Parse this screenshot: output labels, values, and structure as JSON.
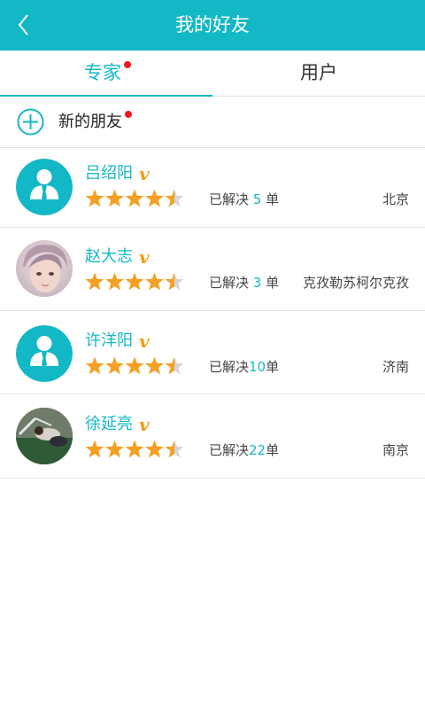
{
  "header": {
    "title": "我的好友"
  },
  "tabs": [
    {
      "label": "专家",
      "active": true,
      "has_dot": true
    },
    {
      "label": "用户",
      "active": false
    }
  ],
  "new_friends": {
    "label": "新的朋友",
    "has_dot": true
  },
  "friends": [
    {
      "name": "吕绍阳",
      "badge": "v",
      "rating": 4.5,
      "solved_prefix": "已解决",
      "solved_count": "5",
      "solved_suffix": "单",
      "city": "北京",
      "avatar": "default"
    },
    {
      "name": "赵大志",
      "badge": "v",
      "rating": 4.5,
      "solved_prefix": "已解决",
      "solved_count": "3",
      "solved_suffix": "单",
      "city": "克孜勒苏柯尔克孜",
      "avatar": "photo-person"
    },
    {
      "name": "许洋阳",
      "badge": "v",
      "rating": 4.5,
      "solved_prefix": "已解决",
      "solved_count": "10",
      "solved_suffix": "单",
      "city": "济南",
      "avatar": "default"
    },
    {
      "name": "徐延亮",
      "badge": "v",
      "rating": 4.5,
      "solved_prefix": "已解决",
      "solved_count": "22",
      "solved_suffix": "单",
      "city": "南京",
      "avatar": "photo-field"
    }
  ],
  "colors": {
    "primary": "#13b8c6",
    "star": "#f4a024",
    "badge": "#f39c12",
    "dot": "#ee1c1c"
  },
  "icons": {
    "back": "chevron-left-icon",
    "add": "plus-circle-icon",
    "rating": "star-icon"
  }
}
